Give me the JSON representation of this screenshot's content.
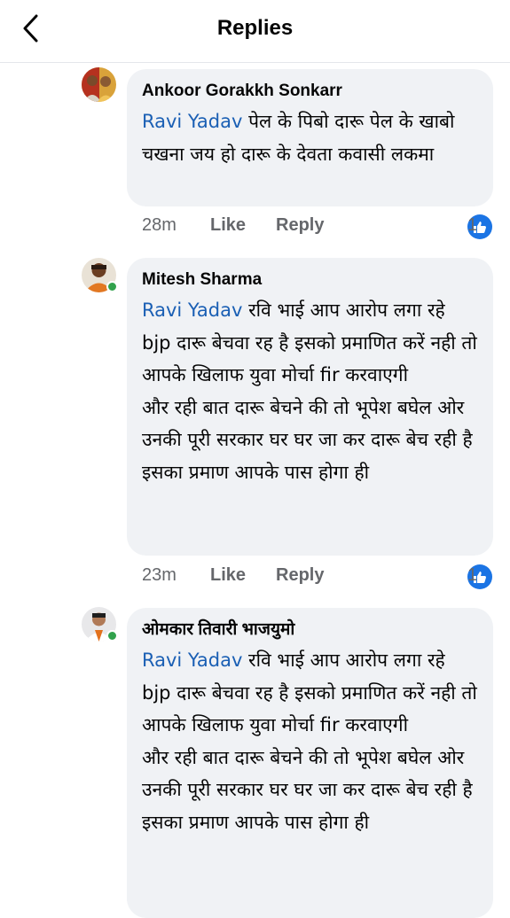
{
  "header": {
    "title": "Replies",
    "back_icon": "chevron-left-icon"
  },
  "comments": [
    {
      "author": "Ankoor Gorakkh Sonkarr",
      "mention": "Ravi Yadav",
      "paragraphs": [
        "पेल के पिबो दारू पेल के खाबो चखना जय हो दारू के देवता कवासी लकमा"
      ],
      "time": "28m",
      "like_label": "Like",
      "reply_label": "Reply",
      "reaction_count": "1",
      "online": false
    },
    {
      "author": "Mitesh Sharma",
      "mention": "Ravi Yadav",
      "paragraphs": [
        "रवि भाई आप आरोप लगा रहे bjp दारू बेचवा रह है इसको प्रमाणित करें नही तो आपके खिलाफ युवा मोर्चा fir करवाएगी",
        "और रही बात दारू बेचने की तो भूपेश बघेल ओर उनकी पूरी सरकार घर घर जा कर दारू बेच रही है",
        "इसका प्रमाण आपके पास होगा ही"
      ],
      "time": "23m",
      "like_label": "Like",
      "reply_label": "Reply",
      "reaction_count": "1",
      "online": true
    },
    {
      "author": "ओमकार तिवारी भाजयुमो",
      "mention": "Ravi Yadav",
      "paragraphs": [
        " रवि भाई आप आरोप लगा रहे bjp दारू बेचवा रह है इसको प्रमाणित करें नही तो आपके खिलाफ युवा मोर्चा fir करवाएगी",
        "और रही बात दारू बेचने की तो भूपेश बघेल ओर उनकी पूरी सरकार घर घर जा कर दारू बेच रही है",
        "इसका प्रमाण आपके पास होगा ही"
      ],
      "online": true
    }
  ],
  "colors": {
    "mention": "#1a5fb4",
    "bubble": "#f0f2f5",
    "like_badge": "#1b74e4",
    "online": "#31a24c"
  }
}
